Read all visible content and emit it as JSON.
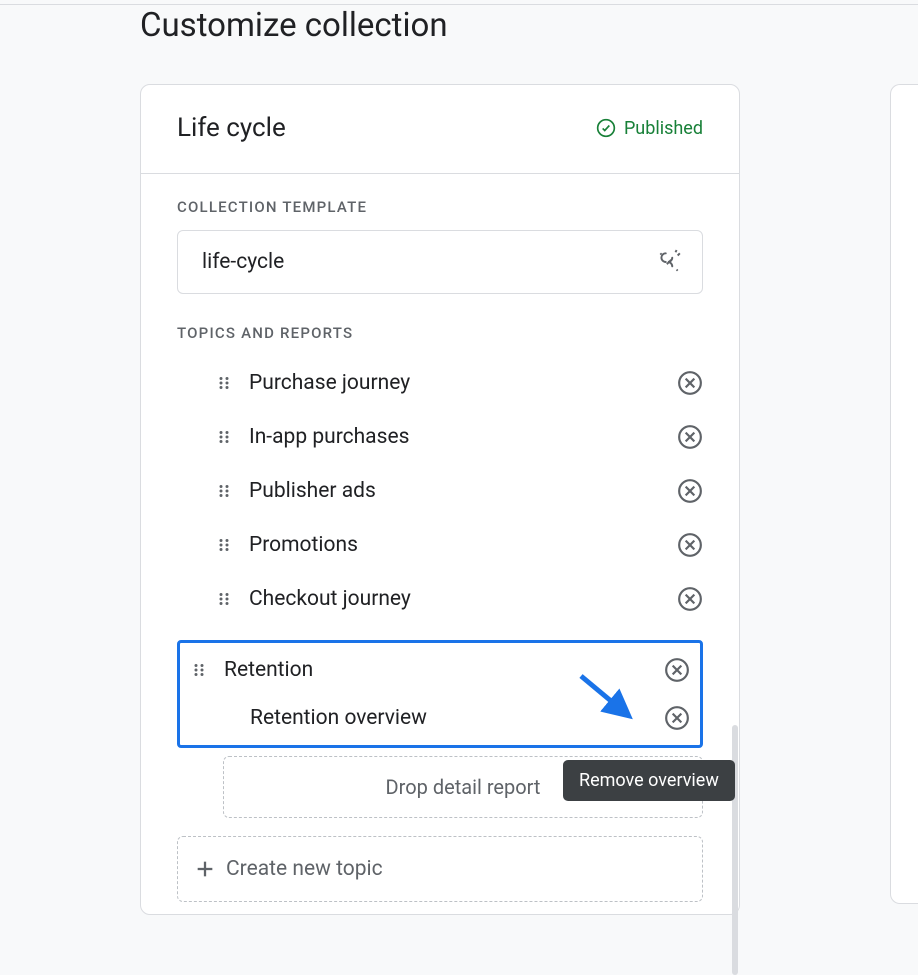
{
  "page_title": "Customize collection",
  "collection": {
    "name": "Life cycle",
    "status_label": "Published"
  },
  "template": {
    "section_label": "COLLECTION TEMPLATE",
    "value": "life-cycle"
  },
  "topics": {
    "section_label": "TOPICS AND REPORTS",
    "reports": [
      {
        "label": "Purchase journey"
      },
      {
        "label": "In-app purchases"
      },
      {
        "label": "Publisher ads"
      },
      {
        "label": "Promotions"
      },
      {
        "label": "Checkout journey"
      }
    ],
    "highlighted_topic": {
      "name": "Retention",
      "sub_report": "Retention overview"
    },
    "drop_zone_label": "Drop detail report",
    "create_topic_label": "Create new topic"
  },
  "tooltip": "Remove overview"
}
